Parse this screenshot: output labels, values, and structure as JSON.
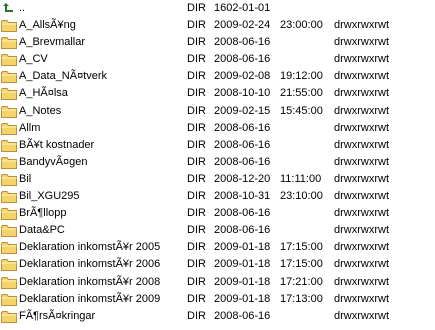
{
  "icons": {
    "folder": "folder-icon",
    "parent": "parent-folder-icon"
  },
  "colors": {
    "folder_body": "#f4d36b",
    "folder_border": "#b8913a",
    "selection": "#316ac5"
  },
  "files": [
    {
      "name": "..",
      "type": "DIR",
      "date": "1602-01-01",
      "time": "",
      "attr": "",
      "icon": "parent"
    },
    {
      "name": "A_AllsÃ¥ng",
      "type": "DIR",
      "date": "2009-02-24",
      "time": "23:00:00",
      "attr": "drwxrwxrwt",
      "icon": "folder"
    },
    {
      "name": "A_Brevmallar",
      "type": "DIR",
      "date": "2008-06-16",
      "time": "",
      "attr": "drwxrwxrwt",
      "icon": "folder"
    },
    {
      "name": "A_CV",
      "type": "DIR",
      "date": "2008-06-16",
      "time": "",
      "attr": "drwxrwxrwt",
      "icon": "folder"
    },
    {
      "name": "A_Data_NÃ¤tverk",
      "type": "DIR",
      "date": "2009-02-08",
      "time": "19:12:00",
      "attr": "drwxrwxrwt",
      "icon": "folder"
    },
    {
      "name": "A_HÃ¤lsa",
      "type": "DIR",
      "date": "2008-10-10",
      "time": "21:55:00",
      "attr": "drwxrwxrwt",
      "icon": "folder"
    },
    {
      "name": "A_Notes",
      "type": "DIR",
      "date": "2009-02-15",
      "time": "15:45:00",
      "attr": "drwxrwxrwt",
      "icon": "folder"
    },
    {
      "name": "Allm",
      "type": "DIR",
      "date": "2008-06-16",
      "time": "",
      "attr": "drwxrwxrwt",
      "icon": "folder"
    },
    {
      "name": "BÃ¥t kostnader",
      "type": "DIR",
      "date": "2008-06-16",
      "time": "",
      "attr": "drwxrwxrwt",
      "icon": "folder"
    },
    {
      "name": "BandyvÃ¤gen",
      "type": "DIR",
      "date": "2008-06-16",
      "time": "",
      "attr": "drwxrwxrwt",
      "icon": "folder"
    },
    {
      "name": "Bil",
      "type": "DIR",
      "date": "2008-12-20",
      "time": "11:11:00",
      "attr": "drwxrwxrwt",
      "icon": "folder"
    },
    {
      "name": "Bil_XGU295",
      "type": "DIR",
      "date": "2008-10-31",
      "time": "23:10:00",
      "attr": "drwxrwxrwt",
      "icon": "folder"
    },
    {
      "name": "BrÃ¶llopp",
      "type": "DIR",
      "date": "2008-06-16",
      "time": "",
      "attr": "drwxrwxrwt",
      "icon": "folder"
    },
    {
      "name": "Data&PC",
      "type": "DIR",
      "date": "2008-06-16",
      "time": "",
      "attr": "drwxrwxrwt",
      "icon": "folder"
    },
    {
      "name": "Deklaration inkomstÃ¥r 2005",
      "type": "DIR",
      "date": "2009-01-18",
      "time": "17:15:00",
      "attr": "drwxrwxrwt",
      "icon": "folder"
    },
    {
      "name": "Deklaration inkomstÃ¥r 2006",
      "type": "DIR",
      "date": "2009-01-18",
      "time": "17:15:00",
      "attr": "drwxrwxrwt",
      "icon": "folder"
    },
    {
      "name": "Deklaration inkomstÃ¥r 2008",
      "type": "DIR",
      "date": "2009-01-18",
      "time": "17:21:00",
      "attr": "drwxrwxrwt",
      "icon": "folder"
    },
    {
      "name": "Deklaration inkomstÃ¥r 2009",
      "type": "DIR",
      "date": "2009-01-18",
      "time": "17:13:00",
      "attr": "drwxrwxrwt",
      "icon": "folder"
    },
    {
      "name": "FÃ¶rsÃ¤kringar",
      "type": "DIR",
      "date": "2008-06-16",
      "time": "",
      "attr": "drwxrwxrwt",
      "icon": "folder"
    }
  ]
}
